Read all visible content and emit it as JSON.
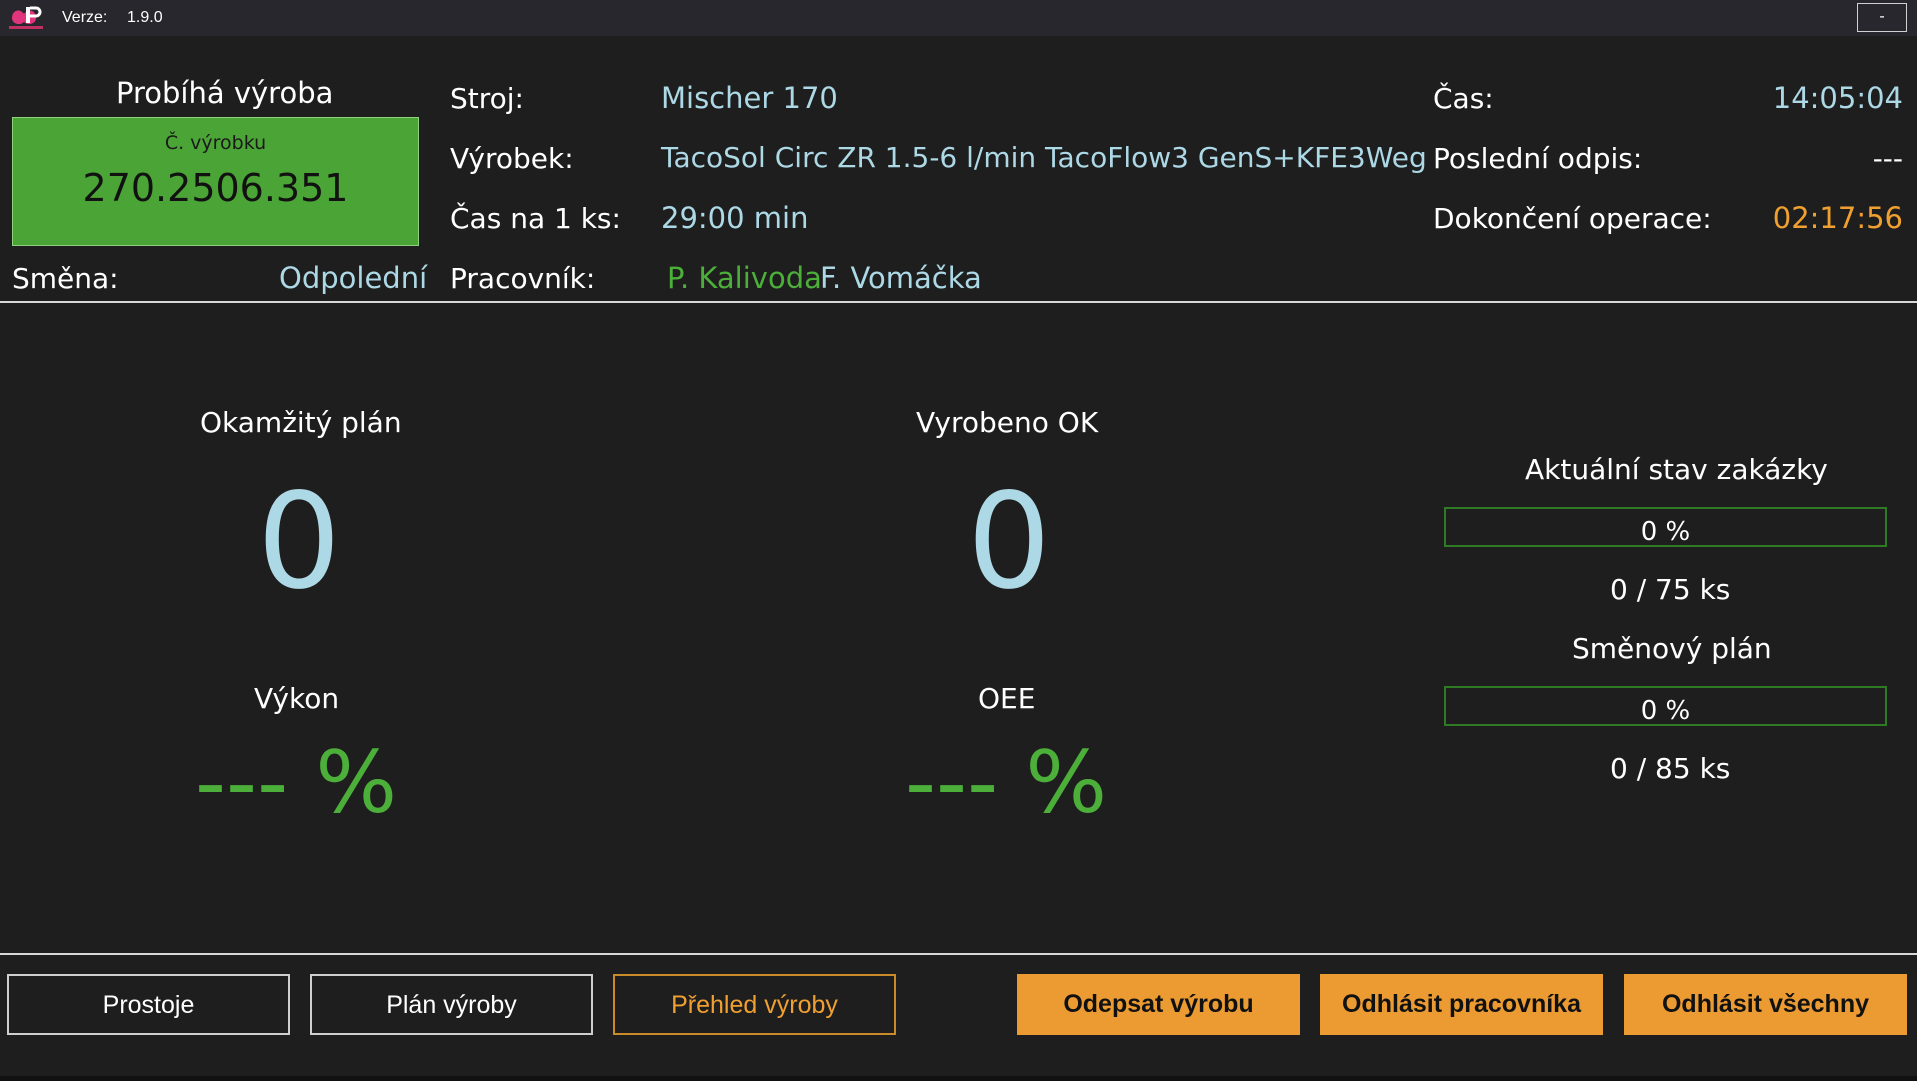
{
  "titlebar": {
    "version_label": "Verze:",
    "version_value": "1.9.0",
    "minimize_label": "-"
  },
  "status": {
    "title": "Probíhá výroba",
    "order_caption": "Č. výrobku",
    "order_number": "270.2506.351",
    "shift_label": "Směna:",
    "shift_value": "Odpolední"
  },
  "info": {
    "machine_label": "Stroj:",
    "machine_value": "Mischer 170",
    "product_label": "Výrobek:",
    "product_value": "TacoSol Circ ZR 1.5-6 l/min TacoFlow3 GenS+KFE3Weg",
    "cycle_label": "Čas na 1 ks:",
    "cycle_value": "29:00 min",
    "worker_label": "Pracovník:",
    "worker_1": "P. Kalivoda",
    "worker_2": "F. Vomáčka"
  },
  "times": {
    "time_label": "Čas:",
    "time_value": "14:05:04",
    "last_label": "Poslední odpis:",
    "last_value": "---",
    "finish_label": "Dokončení operace:",
    "finish_value": "02:17:56"
  },
  "metrics": {
    "plan_label": "Okamžitý plán",
    "plan_value": "0",
    "ok_label": "Vyrobeno OK",
    "ok_value": "0",
    "perf_label": "Výkon",
    "perf_value": "--- %",
    "oee_label": "OEE",
    "oee_value": "--- %"
  },
  "order_status": {
    "title": "Aktuální stav zakázky",
    "progress_fraction": 0,
    "progress_text": "0 %",
    "count_text": "0 / 75 ks"
  },
  "shift_plan": {
    "title": "Směnový plán",
    "progress_fraction": 0,
    "progress_text": "0 %",
    "count_text": "0 / 85 ks"
  },
  "buttons": {
    "downtime": "Prostoje",
    "plan": "Plán výroby",
    "overview": "Přehled výroby",
    "write_off": "Odepsat výrobu",
    "logout_worker": "Odhlásit pracovníka",
    "logout_all": "Odhlásit všechny"
  },
  "colors": {
    "accent_green": "#4caf3a",
    "accent_orange": "#eb9b32",
    "value_blue": "#add8e6"
  }
}
